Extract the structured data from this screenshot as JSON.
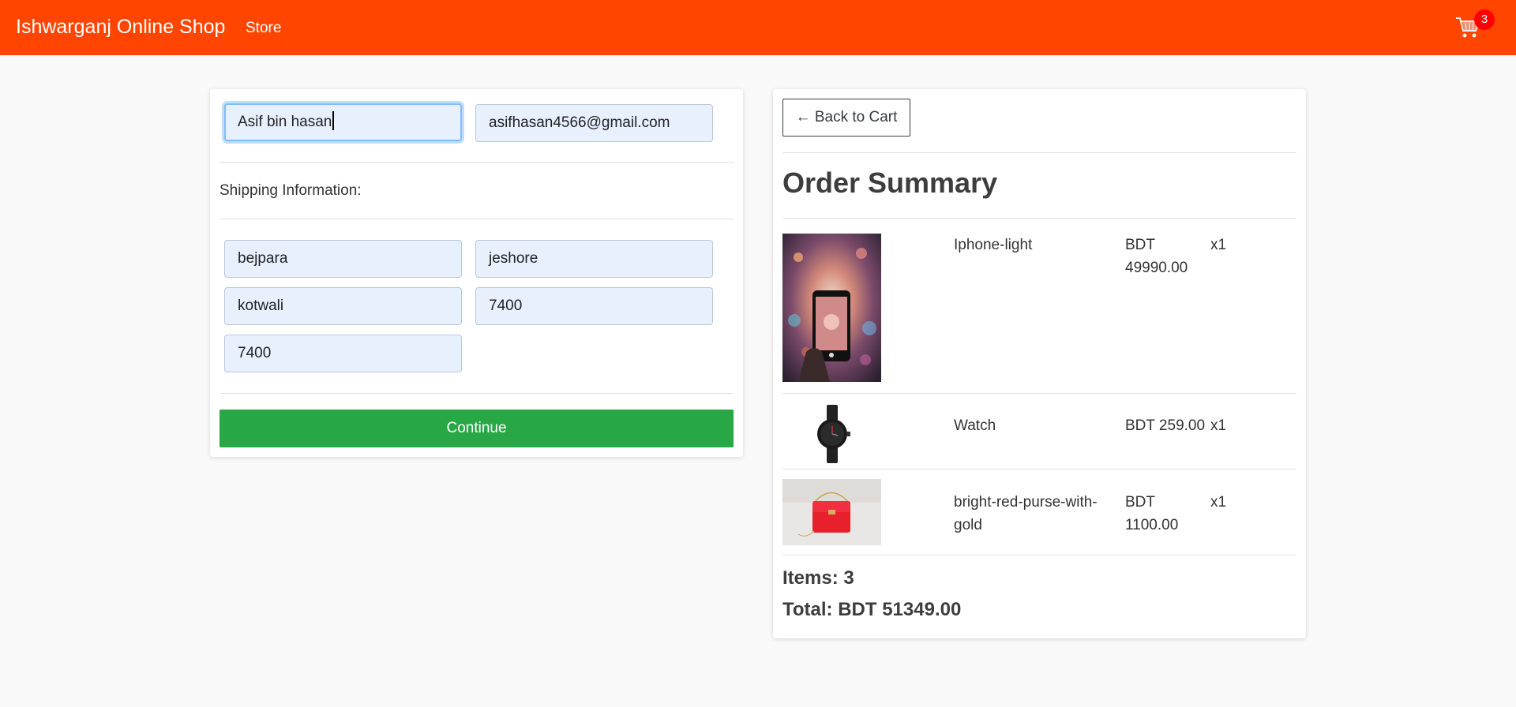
{
  "navbar": {
    "brand": "Ishwarganj Online Shop",
    "store_link": "Store",
    "cart_icon": "cart-icon",
    "cart_count": "3",
    "background_color": "#ff4500"
  },
  "user_form": {
    "name_value": "Asif bin hasan",
    "email_value": "asifhasan4566@gmail.com"
  },
  "shipping": {
    "label": "Shipping Information:",
    "address": "bejpara",
    "city": "jeshore",
    "state": "kotwali",
    "zipcode": "7400",
    "country": "7400"
  },
  "continue_label": "Continue",
  "summary": {
    "back_label": "← Back to Cart",
    "title": "Order Summary",
    "items": [
      {
        "name": "Iphone-light",
        "price": "BDT 49990.00",
        "qty": "x1",
        "image_icon": "phone-photo"
      },
      {
        "name": "Watch",
        "price": "BDT 259.00",
        "qty": "x1",
        "image_icon": "watch-photo"
      },
      {
        "name": "bright-red-purse-with-gold",
        "price": "BDT 1100.00",
        "qty": "x1",
        "image_icon": "purse-photo"
      }
    ],
    "items_total": "Items: 3",
    "total": "Total: BDT 51349.00"
  }
}
